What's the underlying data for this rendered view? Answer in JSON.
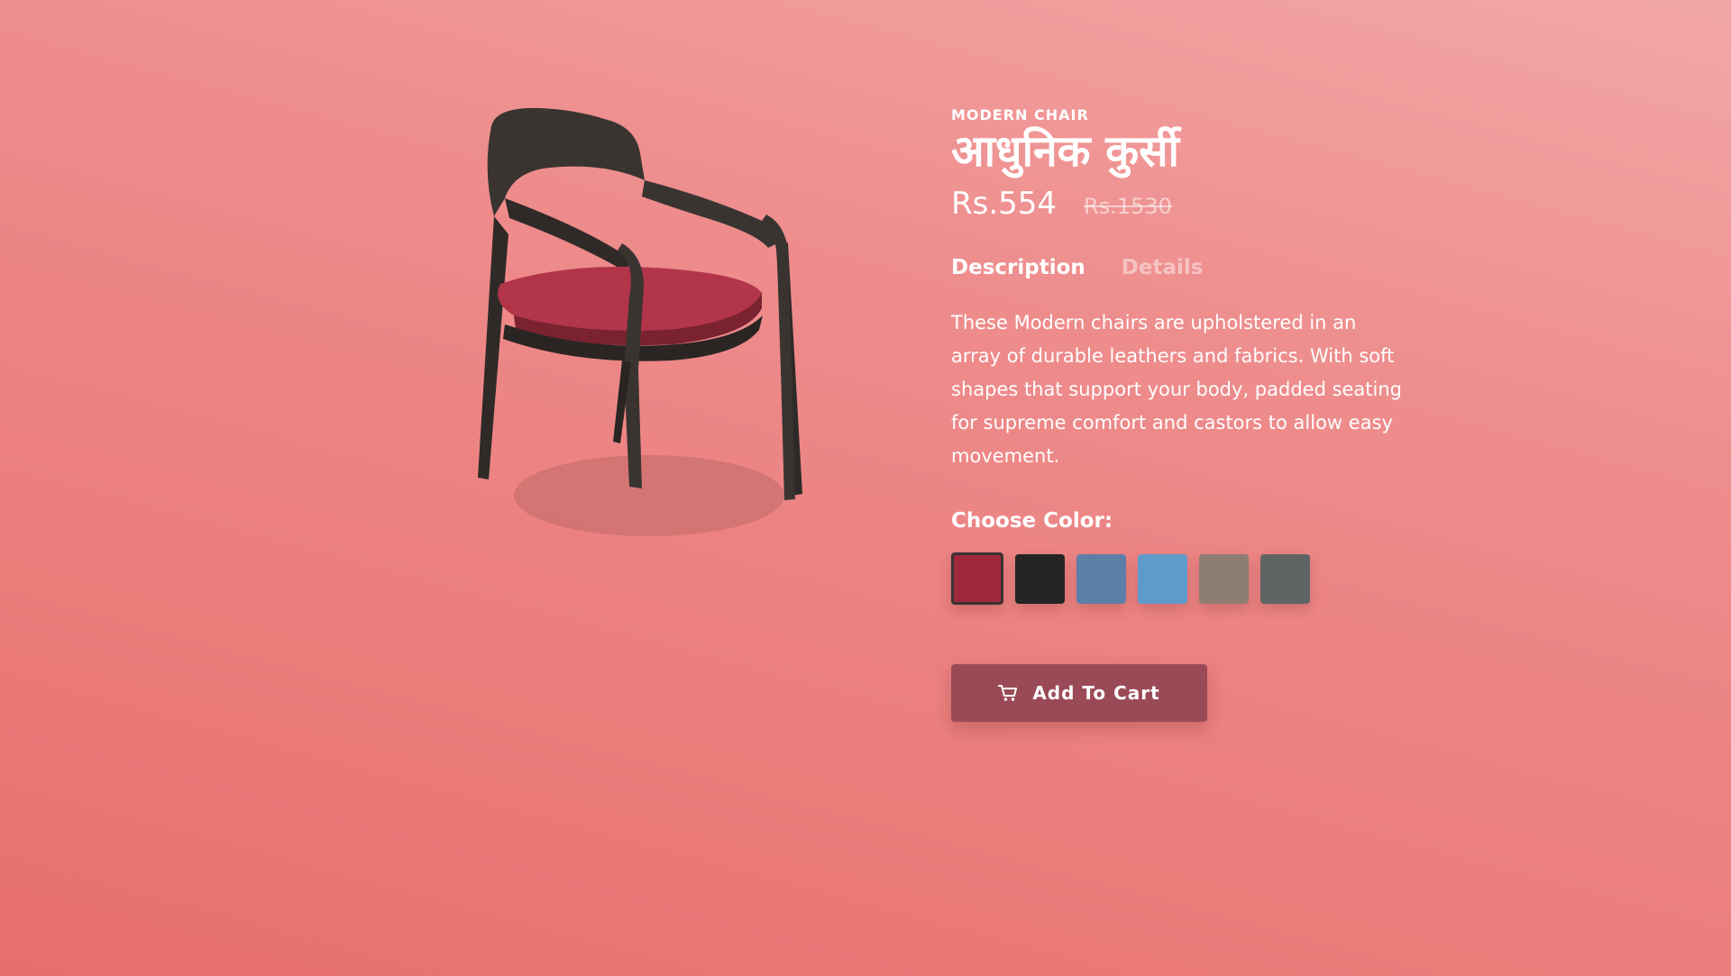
{
  "product": {
    "category": "MODERN CHAIR",
    "title": "आधुनिक कुर्सी",
    "price": "Rs.554",
    "old_price": "Rs.1530"
  },
  "tabs": [
    {
      "label": "Description",
      "active": true
    },
    {
      "label": "Details",
      "active": false
    }
  ],
  "description": "These Modern chairs are upholstered in an array of durable leathers and fabrics. With soft shapes that support your body, padded seating for supreme comfort and castors to allow easy movement.",
  "color_picker": {
    "label": "Choose Color:",
    "swatches": [
      {
        "name": "crimson",
        "color": "#a0283c",
        "selected": true
      },
      {
        "name": "black",
        "color": "#242424",
        "selected": false
      },
      {
        "name": "denim",
        "color": "#5c7fa8",
        "selected": false
      },
      {
        "name": "sky-blue",
        "color": "#5d9bcb",
        "selected": false
      },
      {
        "name": "taupe",
        "color": "#8e7d73",
        "selected": false
      },
      {
        "name": "slate-gray",
        "color": "#5f6564",
        "selected": false
      }
    ]
  },
  "cart_button": {
    "label": "Add To Cart",
    "icon": "cart-icon"
  },
  "colors": {
    "accent": "#9a4a56",
    "background_top": "#f2a7a6",
    "background_bottom": "#e86e6e",
    "chair_wood": "#3a3431",
    "chair_seat": "#b2354a"
  }
}
